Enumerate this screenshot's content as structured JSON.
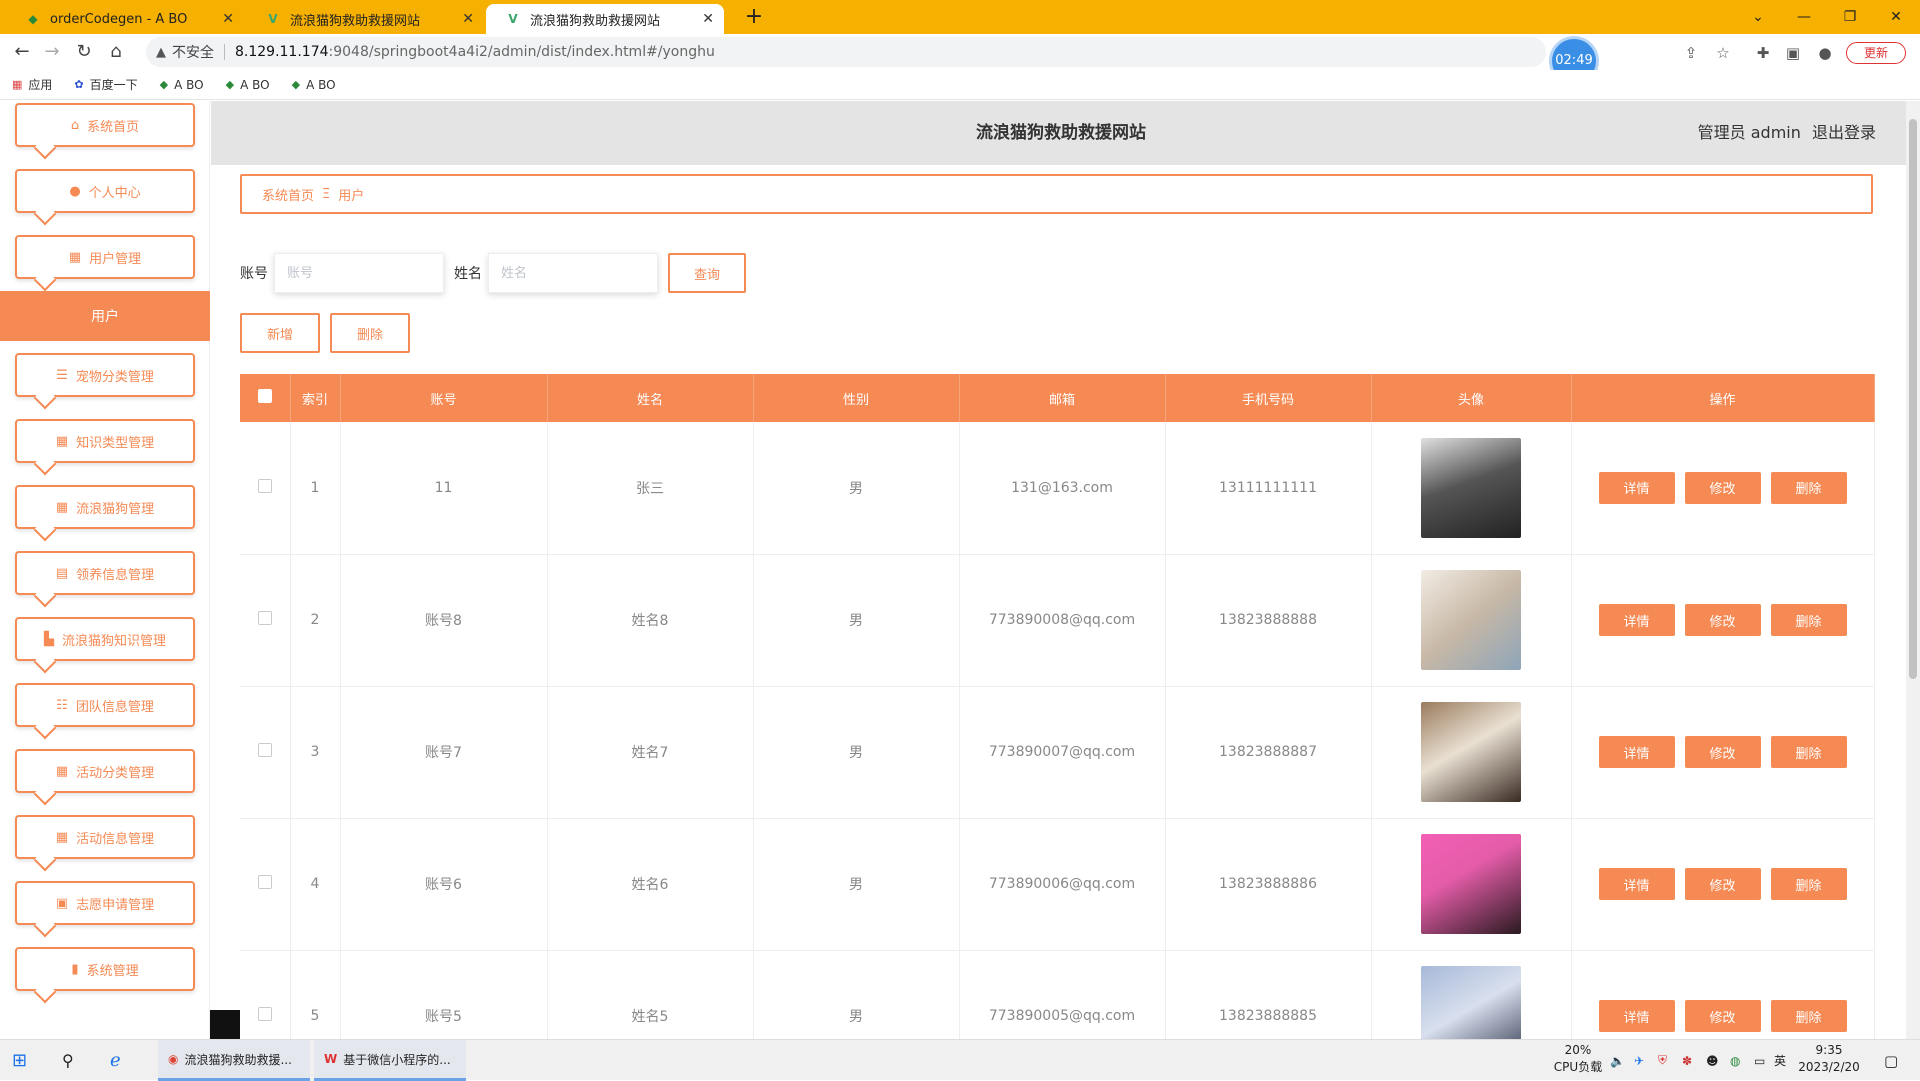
{
  "browser": {
    "tabs": [
      {
        "title": "orderCodegen - A BO",
        "active": false
      },
      {
        "title": "流浪猫狗救助救援网站",
        "active": false
      },
      {
        "title": "流浪猫狗救助救援网站",
        "active": true
      }
    ],
    "new_tab": "+",
    "address": {
      "security_label": "不安全",
      "host": "8.129.11.174",
      "path": ":9048/springboot4a4i2/admin/dist/index.html#/yonghu"
    },
    "timer": "02:49",
    "update_label": "更新",
    "bookmarks": [
      {
        "label": "应用"
      },
      {
        "label": "百度一下"
      },
      {
        "label": "A BO"
      },
      {
        "label": "A BO"
      },
      {
        "label": "A BO"
      }
    ]
  },
  "sidebar": {
    "items": [
      {
        "label": "系统首页",
        "icon": "home-icon"
      },
      {
        "label": "个人中心",
        "icon": "user-icon"
      },
      {
        "label": "用户管理",
        "icon": "grid-icon"
      },
      {
        "label": "用户",
        "active": true
      },
      {
        "label": "宠物分类管理",
        "icon": "list-icon"
      },
      {
        "label": "知识类型管理",
        "icon": "grid-icon"
      },
      {
        "label": "流浪猫狗管理",
        "icon": "grid-icon"
      },
      {
        "label": "领养信息管理",
        "icon": "film-icon"
      },
      {
        "label": "流浪猫狗知识管理",
        "icon": "briefcase-icon"
      },
      {
        "label": "团队信息管理",
        "icon": "sliders-icon"
      },
      {
        "label": "活动分类管理",
        "icon": "grid-icon"
      },
      {
        "label": "活动信息管理",
        "icon": "grid-icon"
      },
      {
        "label": "志愿申请管理",
        "icon": "clipboard-icon"
      },
      {
        "label": "系统管理",
        "icon": "chart-icon"
      }
    ]
  },
  "header": {
    "title": "流浪猫狗救助救援网站",
    "role": "管理员 admin",
    "logout": "退出登录"
  },
  "breadcrumb": {
    "home": "系统首页",
    "separator": "Ξ",
    "current": "用户"
  },
  "search": {
    "account_label": "账号",
    "account_placeholder": "账号",
    "name_label": "姓名",
    "name_placeholder": "姓名",
    "query_button": "查询"
  },
  "actions": {
    "add": "新增",
    "delete": "删除"
  },
  "table": {
    "columns": [
      "索引",
      "账号",
      "姓名",
      "性别",
      "邮箱",
      "手机号码",
      "头像",
      "操作"
    ],
    "rows": [
      {
        "index": "1",
        "account": "11",
        "name": "张三",
        "gender": "男",
        "email": "131@163.com",
        "phone": "13111111111"
      },
      {
        "index": "2",
        "account": "账号8",
        "name": "姓名8",
        "gender": "男",
        "email": "773890008@qq.com",
        "phone": "13823888888"
      },
      {
        "index": "3",
        "account": "账号7",
        "name": "姓名7",
        "gender": "男",
        "email": "773890007@qq.com",
        "phone": "13823888887"
      },
      {
        "index": "4",
        "account": "账号6",
        "name": "姓名6",
        "gender": "男",
        "email": "773890006@qq.com",
        "phone": "13823888886"
      },
      {
        "index": "5",
        "account": "账号5",
        "name": "姓名5",
        "gender": "男",
        "email": "773890005@qq.com",
        "phone": "13823888885"
      }
    ],
    "row_actions": {
      "detail": "详情",
      "edit": "修改",
      "delete": "删除"
    }
  },
  "taskbar": {
    "tasks": [
      {
        "label": "流浪猫狗救助救援..."
      },
      {
        "label": "基于微信小程序的..."
      }
    ],
    "cpu_percent": "20%",
    "cpu_label": "CPU负载",
    "ime": "英",
    "time": "9:35",
    "date": "2023/2/20"
  },
  "colors": {
    "accent": "#f58a54",
    "tabbar": "#f5b000"
  }
}
